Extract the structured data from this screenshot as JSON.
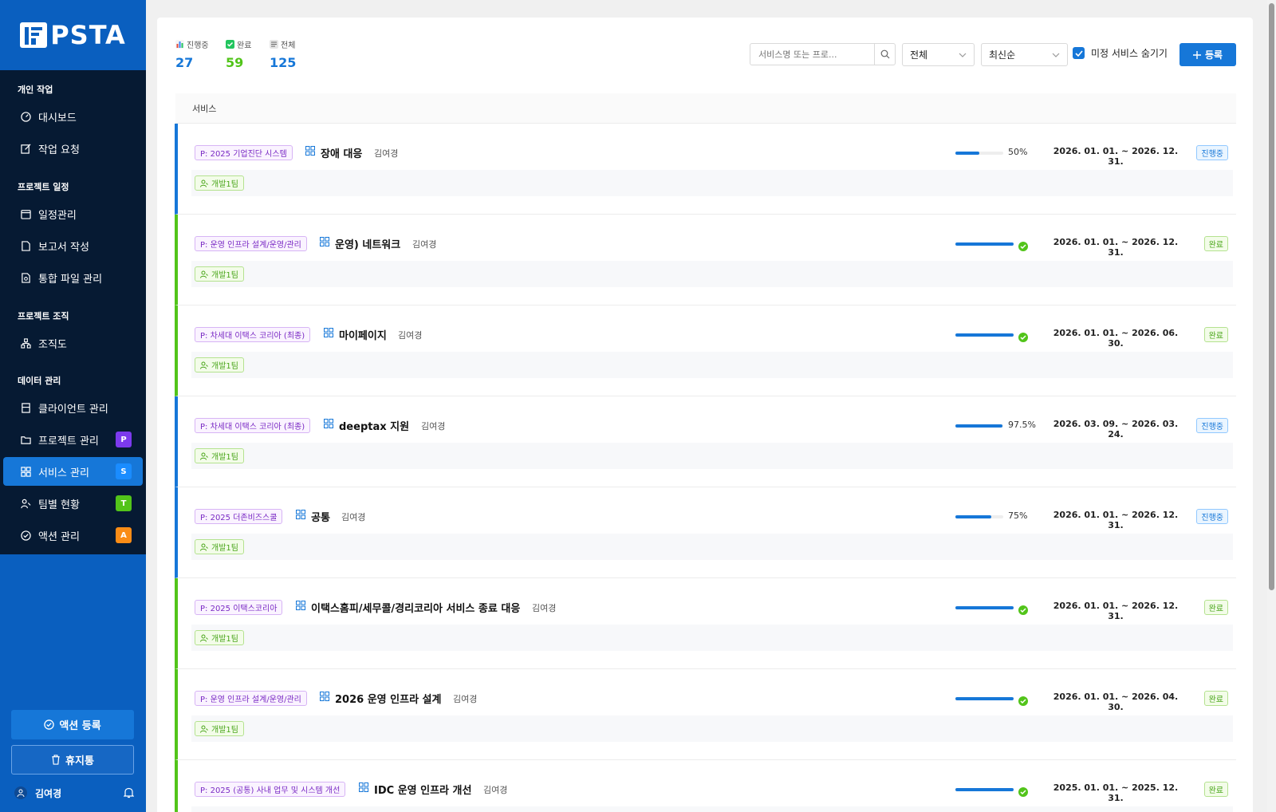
{
  "brand": {
    "name": "PSTA",
    "color": "#0a5fbf"
  },
  "sidebar": {
    "sections": [
      {
        "title": "개인 작업",
        "items": [
          {
            "label": "대시보드",
            "icon": "dashboard-icon"
          },
          {
            "label": "작업 요청",
            "icon": "edit-icon"
          }
        ]
      },
      {
        "title": "프로젝트 일정",
        "items": [
          {
            "label": "일정관리",
            "icon": "calendar-icon"
          },
          {
            "label": "보고서 작성",
            "icon": "document-icon"
          },
          {
            "label": "통합 파일 관리",
            "icon": "file-search-icon"
          }
        ]
      },
      {
        "title": "프로젝트 조직",
        "items": [
          {
            "label": "조직도",
            "icon": "org-chart-icon"
          }
        ]
      },
      {
        "title": "데이터 관리",
        "items": [
          {
            "label": "클라이언트 관리",
            "icon": "building-icon"
          },
          {
            "label": "프로젝트 관리",
            "icon": "folder-icon",
            "badge": "P",
            "badge_color": "#7c3aed"
          },
          {
            "label": "서비스 관리",
            "icon": "grid-icon",
            "badge": "S",
            "badge_color": "#1677d8",
            "active": true
          },
          {
            "label": "팀별 현황",
            "icon": "team-icon",
            "badge": "T",
            "badge_color": "#52c41a"
          },
          {
            "label": "액션 관리",
            "icon": "check-circle-icon",
            "badge": "A",
            "badge_color": "#fa8c16"
          }
        ]
      }
    ],
    "action_button": "액션 등록",
    "trash_button": "휴지통",
    "user_name": "김여경"
  },
  "stats": [
    {
      "label": "진행중",
      "value": "27",
      "color": "#1677d8"
    },
    {
      "label": "완료",
      "value": "59",
      "color": "#52c41a"
    },
    {
      "label": "전체",
      "value": "125",
      "color": "#1677d8"
    }
  ],
  "toolbar": {
    "search_placeholder": "서비스명 또는 프로...",
    "filter_value": "전체",
    "sort_value": "최신순",
    "hide_unassigned_label": "미정 서비스 숨기기",
    "hide_unassigned_checked": true,
    "add_button": "등록"
  },
  "table": {
    "header": "서비스",
    "rows": [
      {
        "project": "P: 2025 기업진단 시스템",
        "service": "장애 대응",
        "owner": "김여경",
        "progress": 50,
        "progress_label": "50%",
        "dates": "2026. 01. 01. ~ 2026. 12. 31.",
        "status": "진행중",
        "team": "개발1팀"
      },
      {
        "project": "P: 운영 인프라 설계/운영/관리",
        "service": "운영) 네트워크",
        "owner": "김여경",
        "progress": 100,
        "progress_label": "",
        "dates": "2026. 01. 01. ~ 2026. 12. 31.",
        "status": "완료",
        "team": "개발1팀"
      },
      {
        "project": "P: 차세대 이택스 코리아 (최종)",
        "service": "마이페이지",
        "owner": "김여경",
        "progress": 100,
        "progress_label": "",
        "dates": "2026. 01. 01. ~ 2026. 06. 30.",
        "status": "완료",
        "team": "개발1팀"
      },
      {
        "project": "P: 차세대 이택스 코리아 (최종)",
        "service": "deeptax 지원",
        "owner": "김여경",
        "progress": 97.5,
        "progress_label": "97.5%",
        "dates": "2026. 03. 09. ~ 2026. 03. 24.",
        "status": "진행중",
        "team": "개발1팀"
      },
      {
        "project": "P: 2025 더존비즈스쿨",
        "service": "공통",
        "owner": "김여경",
        "progress": 75,
        "progress_label": "75%",
        "dates": "2026. 01. 01. ~ 2026. 12. 31.",
        "status": "진행중",
        "team": "개발1팀"
      },
      {
        "project": "P: 2025 이택스코리아",
        "service": "이택스홈피/세무콜/경리코리아 서비스 종료 대응",
        "owner": "김여경",
        "progress": 100,
        "progress_label": "",
        "dates": "2026. 01. 01. ~ 2026. 12. 31.",
        "status": "완료",
        "team": "개발1팀"
      },
      {
        "project": "P: 운영 인프라 설계/운영/관리",
        "service": "2026 운영 인프라 설계",
        "owner": "김여경",
        "progress": 100,
        "progress_label": "",
        "dates": "2026. 01. 01. ~ 2026. 04. 30.",
        "status": "완료",
        "team": "개발1팀"
      },
      {
        "project": "P: 2025 (공통) 사내 업무 및 시스템 개선",
        "service": "IDC 운영 인프라 개선",
        "owner": "김여경",
        "progress": 100,
        "progress_label": "",
        "dates": "2025. 01. 01. ~ 2025. 12. 31.",
        "status": "완료",
        "team": ""
      }
    ]
  }
}
